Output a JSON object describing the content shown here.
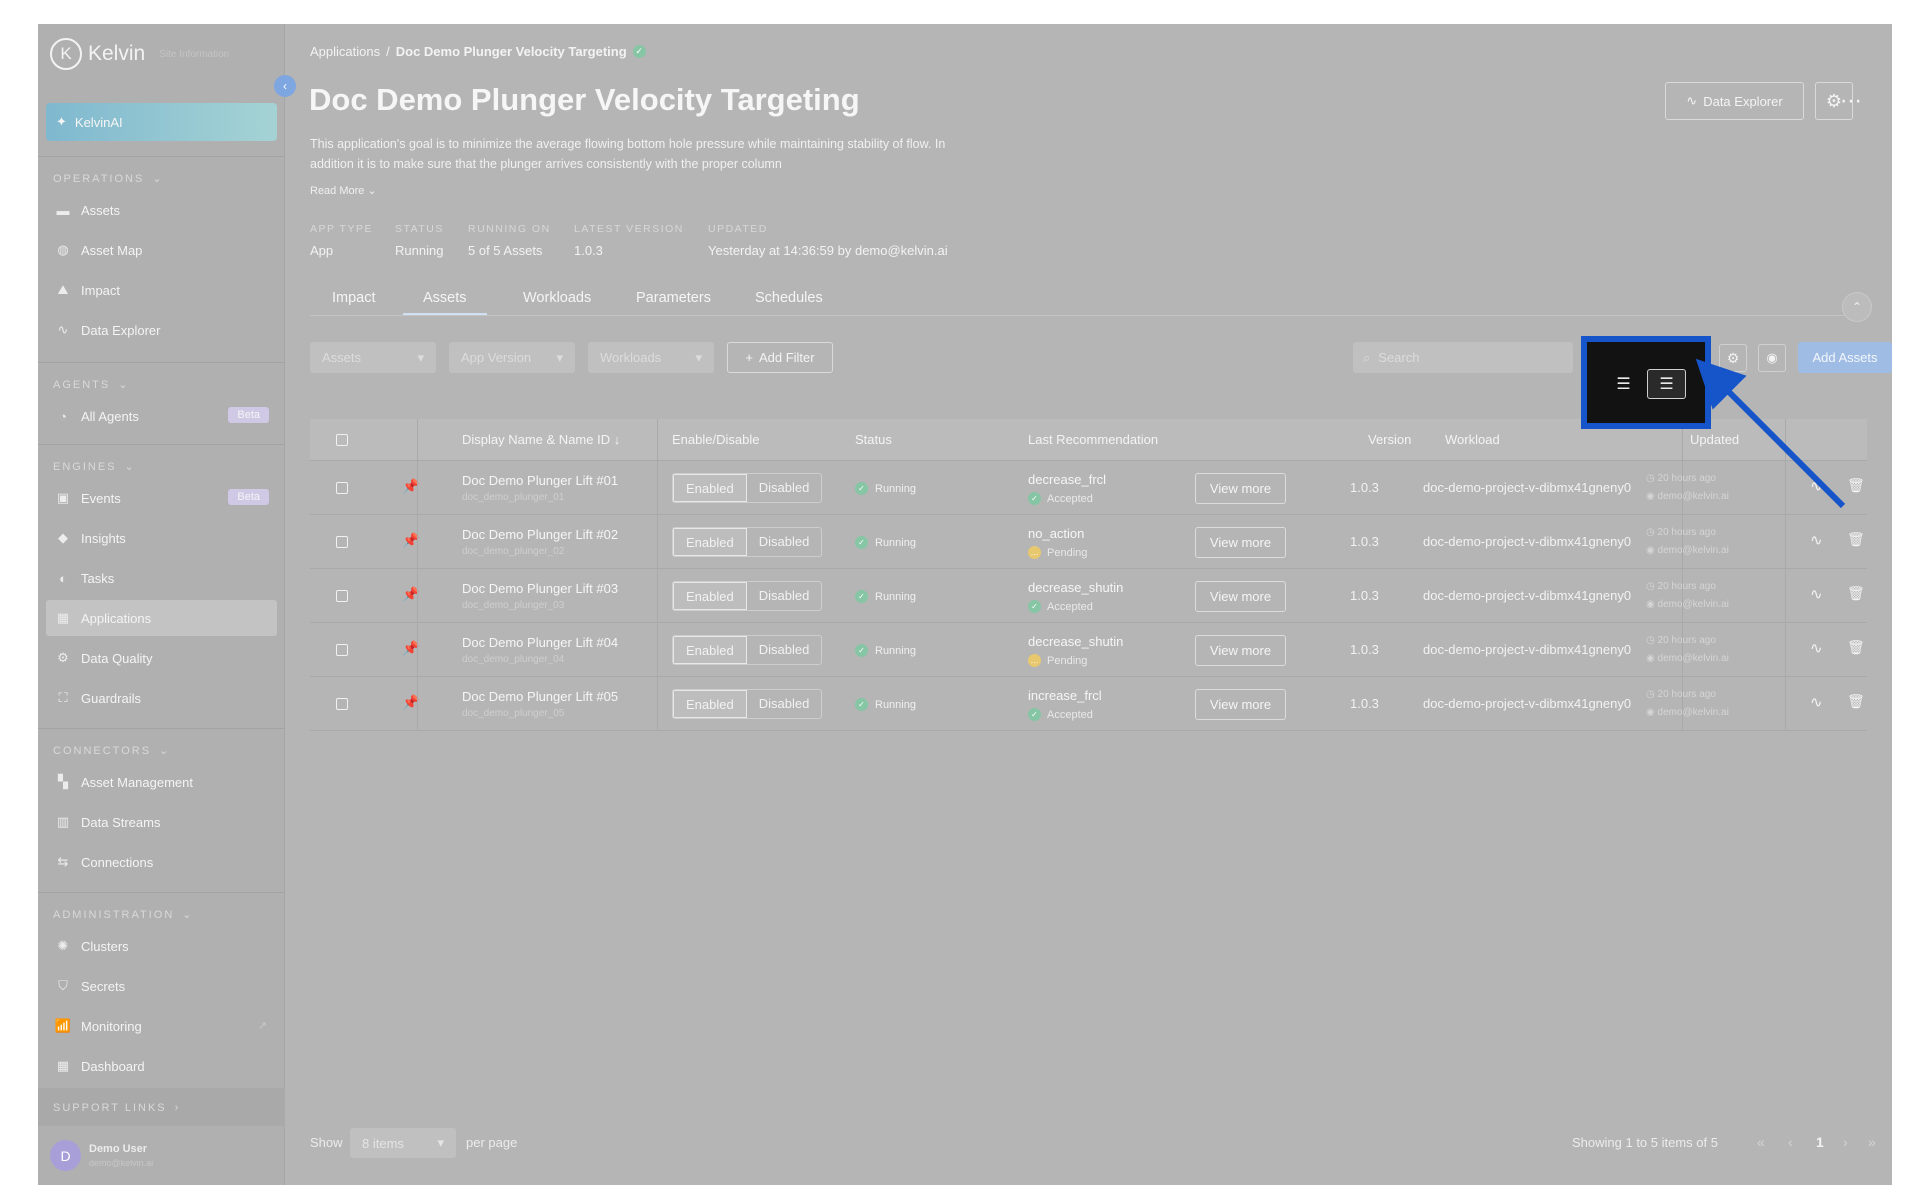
{
  "sidebar": {
    "logo": "Kelvin",
    "logo_sub": "Site Information",
    "kelvin_ai": "KelvinAI",
    "sections": {
      "operations": "OPERATIONS",
      "agents": "AGENTS",
      "engines": "ENGINES",
      "connectors": "CONNECTORS",
      "administration": "ADMINISTRATION",
      "support": "SUPPORT LINKS"
    },
    "items": {
      "assets": "Assets",
      "asset_map": "Asset Map",
      "impact": "Impact",
      "data_explorer": "Data Explorer",
      "all_agents": "All Agents",
      "events": "Events",
      "insights": "Insights",
      "tasks": "Tasks",
      "applications": "Applications",
      "data_quality": "Data Quality",
      "guardrails": "Guardrails",
      "asset_management": "Asset Management",
      "data_streams": "Data Streams",
      "connections": "Connections",
      "clusters": "Clusters",
      "secrets": "Secrets",
      "monitoring": "Monitoring",
      "dashboard": "Dashboard"
    },
    "beta": "Beta",
    "user": {
      "initial": "D",
      "name": "Demo User",
      "email": "demo@kelvin.ai"
    }
  },
  "header": {
    "breadcrumb_root": "Applications",
    "breadcrumb_sep": "/",
    "breadcrumb_current": "Doc Demo Plunger Velocity Targeting",
    "title": "Doc Demo Plunger Velocity Targeting",
    "description": "This application's goal is to minimize the average flowing bottom hole pressure while maintaining stability of flow. In addition it is to make sure that the plunger arrives consistently with the proper column",
    "read_more": "Read More",
    "data_explorer_button": "Data Explorer"
  },
  "meta": {
    "app_type_label": "APP TYPE",
    "app_type": "App",
    "status_label": "STATUS",
    "status": "Running",
    "running_on_label": "RUNNING ON",
    "running_on": "5 of 5 Assets",
    "latest_version_label": "LATEST VERSION",
    "latest_version": "1.0.3",
    "updated_label": "UPDATED",
    "updated": "Yesterday at 14:36:59 by demo@kelvin.ai"
  },
  "tabs": [
    "Impact",
    "Assets",
    "Workloads",
    "Parameters",
    "Schedules"
  ],
  "toolbar": {
    "filter_assets": "Assets",
    "filter_app_version": "App Version",
    "filter_workloads": "Workloads",
    "add_filter": "Add Filter",
    "search_placeholder": "Search",
    "add_assets": "Add Assets"
  },
  "table": {
    "headers": {
      "display_name": "Display Name & Name ID",
      "enable_disable": "Enable/Disable",
      "status": "Status",
      "last_recommendation": "Last Recommendation",
      "version": "Version",
      "workload": "Workload",
      "updated": "Updated"
    },
    "enabled_label": "Enabled",
    "disabled_label": "Disabled",
    "view_more": "View more",
    "rows": [
      {
        "name": "Doc Demo Plunger Lift #01",
        "id": "doc_demo_plunger_01",
        "status": "Running",
        "rec": "decrease_frcl",
        "rec_status": "Accepted",
        "version": "1.0.3",
        "workload": "doc-demo-project-v-dibmx41gneny0",
        "updated": "20 hours ago",
        "by": "demo@kelvin.ai"
      },
      {
        "name": "Doc Demo Plunger Lift #02",
        "id": "doc_demo_plunger_02",
        "status": "Running",
        "rec": "no_action",
        "rec_status": "Pending",
        "version": "1.0.3",
        "workload": "doc-demo-project-v-dibmx41gneny0",
        "updated": "20 hours ago",
        "by": "demo@kelvin.ai"
      },
      {
        "name": "Doc Demo Plunger Lift #03",
        "id": "doc_demo_plunger_03",
        "status": "Running",
        "rec": "decrease_shutin",
        "rec_status": "Accepted",
        "version": "1.0.3",
        "workload": "doc-demo-project-v-dibmx41gneny0",
        "updated": "20 hours ago",
        "by": "demo@kelvin.ai"
      },
      {
        "name": "Doc Demo Plunger Lift #04",
        "id": "doc_demo_plunger_04",
        "status": "Running",
        "rec": "decrease_shutin",
        "rec_status": "Pending",
        "version": "1.0.3",
        "workload": "doc-demo-project-v-dibmx41gneny0",
        "updated": "20 hours ago",
        "by": "demo@kelvin.ai"
      },
      {
        "name": "Doc Demo Plunger Lift #05",
        "id": "doc_demo_plunger_05",
        "status": "Running",
        "rec": "increase_frcl",
        "rec_status": "Accepted",
        "version": "1.0.3",
        "workload": "doc-demo-project-v-dibmx41gneny0",
        "updated": "20 hours ago",
        "by": "demo@kelvin.ai"
      }
    ]
  },
  "pager": {
    "show": "Show",
    "per_page_value": "8 items",
    "per_page": "per page",
    "showing": "Showing 1 to 5 items of 5",
    "page": "1"
  },
  "colors": {
    "overlay": "#b5b5b5",
    "highlight_border": "#1554c9",
    "arrow": "#1554c9",
    "primary_button": "#9fbde4",
    "running": "#86c6a4",
    "pending": "#e8c86e"
  }
}
